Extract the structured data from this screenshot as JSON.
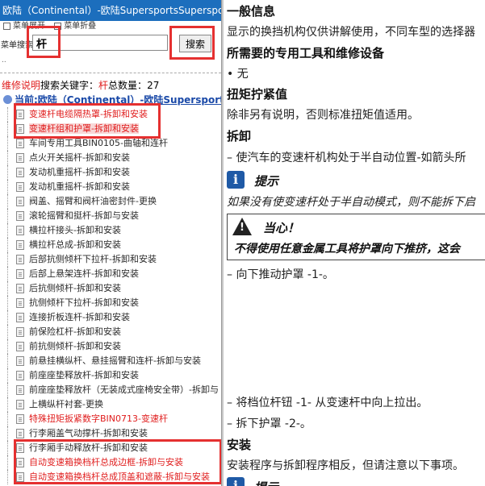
{
  "left_panel": {
    "title": "欧陆（Continental）-欧陆SupersportsSupersports",
    "menu": [
      {
        "label": "菜单展开"
      },
      {
        "label": "菜单折叠"
      }
    ],
    "search": {
      "label": "菜单搜索",
      "value": "杆",
      "button": "搜索"
    },
    "dots": "..",
    "summary": {
      "prefix": "维修说明",
      "middle": "搜索关键字：",
      "keyword": "杆",
      "count_label": "总数量：",
      "count": "27"
    },
    "root": "当前:欧陆（Continental）-欧陆Supersports",
    "items": [
      {
        "label": "变速杆电缆隔热罩-拆卸和安装",
        "style": "red"
      },
      {
        "label": "变速杆组和护罩-拆卸和安装",
        "style": "sel"
      },
      {
        "label": "车间专用工具BIN0105-曲轴和连杆",
        "style": ""
      },
      {
        "label": "点火开关摇杆-拆卸和安装",
        "style": ""
      },
      {
        "label": "发动机重摇杆-拆卸和安装",
        "style": ""
      },
      {
        "label": "发动机重摇杆-拆卸和安装",
        "style": ""
      },
      {
        "label": "阀盖、摇臂和阀杆油密封件-更换",
        "style": ""
      },
      {
        "label": "滚轮摇臂和挺杆-拆卸与安装",
        "style": ""
      },
      {
        "label": "横拉杆接头-拆卸和安装",
        "style": ""
      },
      {
        "label": "横拉杆总成-拆卸和安装",
        "style": ""
      },
      {
        "label": "后部抗侧倾杆下拉杆-拆卸和安装",
        "style": ""
      },
      {
        "label": "后部上悬架连杆-拆卸和安装",
        "style": ""
      },
      {
        "label": "后抗侧倾杆-拆卸和安装",
        "style": ""
      },
      {
        "label": "抗侧倾杆下拉杆-拆卸和安装",
        "style": ""
      },
      {
        "label": "连接折板连杆-拆卸和安装",
        "style": ""
      },
      {
        "label": "前保险杠杆-拆卸和安装",
        "style": ""
      },
      {
        "label": "前抗侧倾杆-拆卸和安装",
        "style": ""
      },
      {
        "label": "前悬挂横纵杆、悬挂摇臂和连杆-拆卸与安装",
        "style": ""
      },
      {
        "label": "前座座垫释放杆-拆卸和安装",
        "style": ""
      },
      {
        "label": "前座座垫释放杆（无装成式座椅安全带）-拆卸与",
        "style": ""
      },
      {
        "label": "上横纵杆衬套-更换",
        "style": ""
      },
      {
        "label": "特殊扭矩扳紧数字BIN0713-变速杆",
        "style": "red"
      },
      {
        "label": "行李厢盖气动撑杆-拆卸和安装",
        "style": ""
      },
      {
        "label": "行李厢手动释放杆-拆卸和安装",
        "style": ""
      },
      {
        "label": "自动变速箱换档杆总成边框-拆卸与安装",
        "style": "red"
      },
      {
        "label": "自动变速箱换档杆总成顶盖和遮蔽-拆卸与安装",
        "style": "red"
      }
    ]
  },
  "right_panel": {
    "general_heading": "一般信息",
    "general_text": "显示的换挡机构仅供讲解使用，不同车型的选择器",
    "tools_heading": "所需要的专用工具和维修设备",
    "tools_item": "• 无",
    "torque_heading": "扭矩拧紧值",
    "torque_text": "除非另有说明，否则标准扭矩值适用。",
    "removal_heading": "拆卸",
    "step1": "– 使汽车的变速杆机构处于半自动位置-如箭头所",
    "tip_label": "提示",
    "tip_text": "如果没有使变速杆处于半自动模式，则不能拆下启",
    "caution_label": "当心！",
    "caution_text": "不得使用任意金属工具将护罩向下推挤，这会",
    "step2": "– 向下推动护罩 -1-。",
    "step3": "– 将档位杆钮 -1- 从变速杆中向上拉出。",
    "step4": "– 拆下护罩 -2-。",
    "install_heading": "安装",
    "install_text": "安装程序与拆卸程序相反，但请注意以下事项。",
    "tip2_label": "提示"
  }
}
